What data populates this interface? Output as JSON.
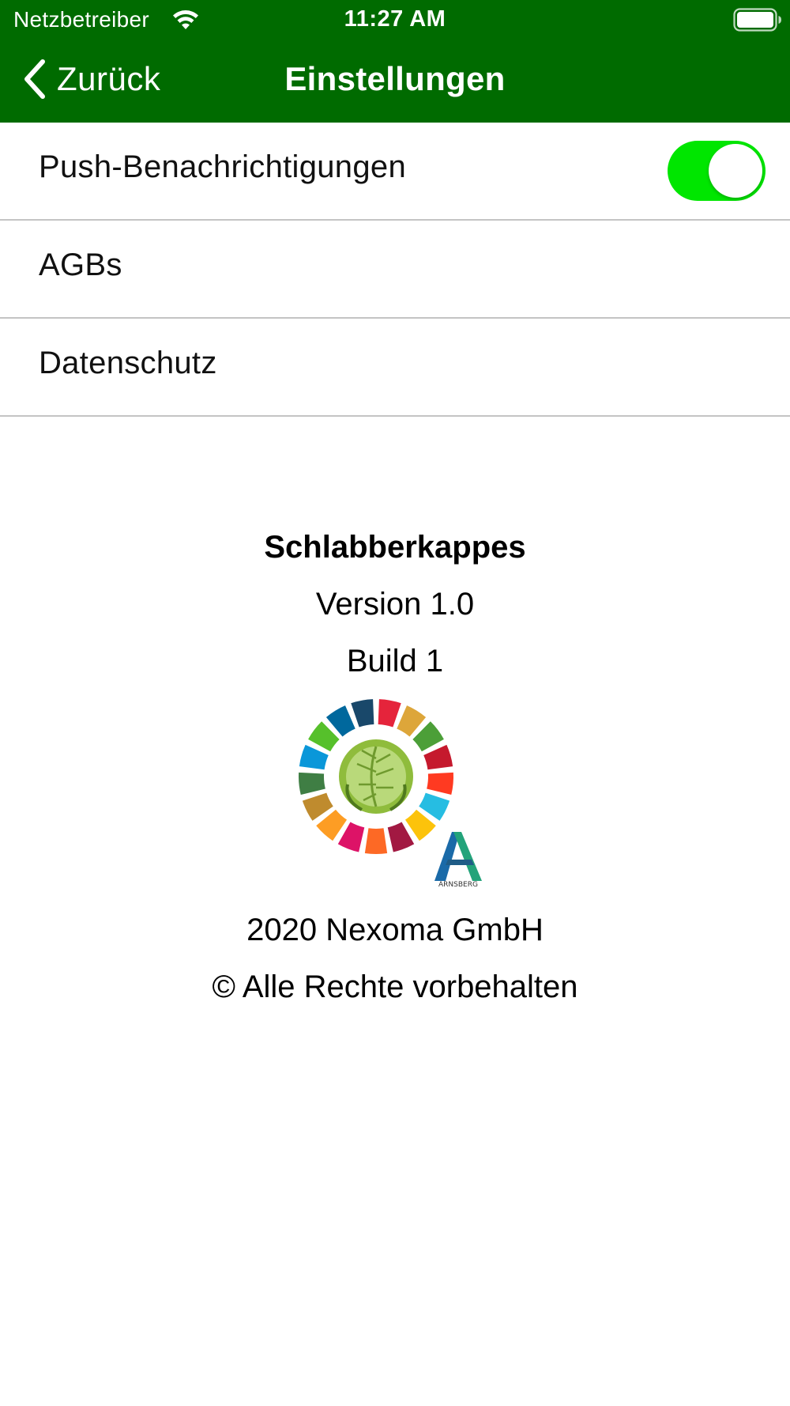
{
  "status_bar": {
    "carrier": "Netzbetreiber",
    "time": "11:27 AM"
  },
  "nav": {
    "back_label": "Zurück",
    "title": "Einstellungen"
  },
  "settings": {
    "items": [
      {
        "label": "Push-Benachrichtigungen",
        "toggle": true
      },
      {
        "label": "AGBs"
      },
      {
        "label": "Datenschutz"
      }
    ]
  },
  "about": {
    "app_name": "Schlabberkappes",
    "version": "Version 1.0",
    "build": "Build 1",
    "logo_caption": "ARNSBERG",
    "copyright_company": "2020 Nexoma GmbH",
    "rights": "© Alle Rechte vorbehalten"
  },
  "colors": {
    "header_bg": "#006b00",
    "toggle_on": "#00e600",
    "separator": "#c4c4c4"
  },
  "icons": {
    "back": "chevron-left-icon",
    "wifi": "wifi-icon",
    "battery": "battery-icon"
  }
}
